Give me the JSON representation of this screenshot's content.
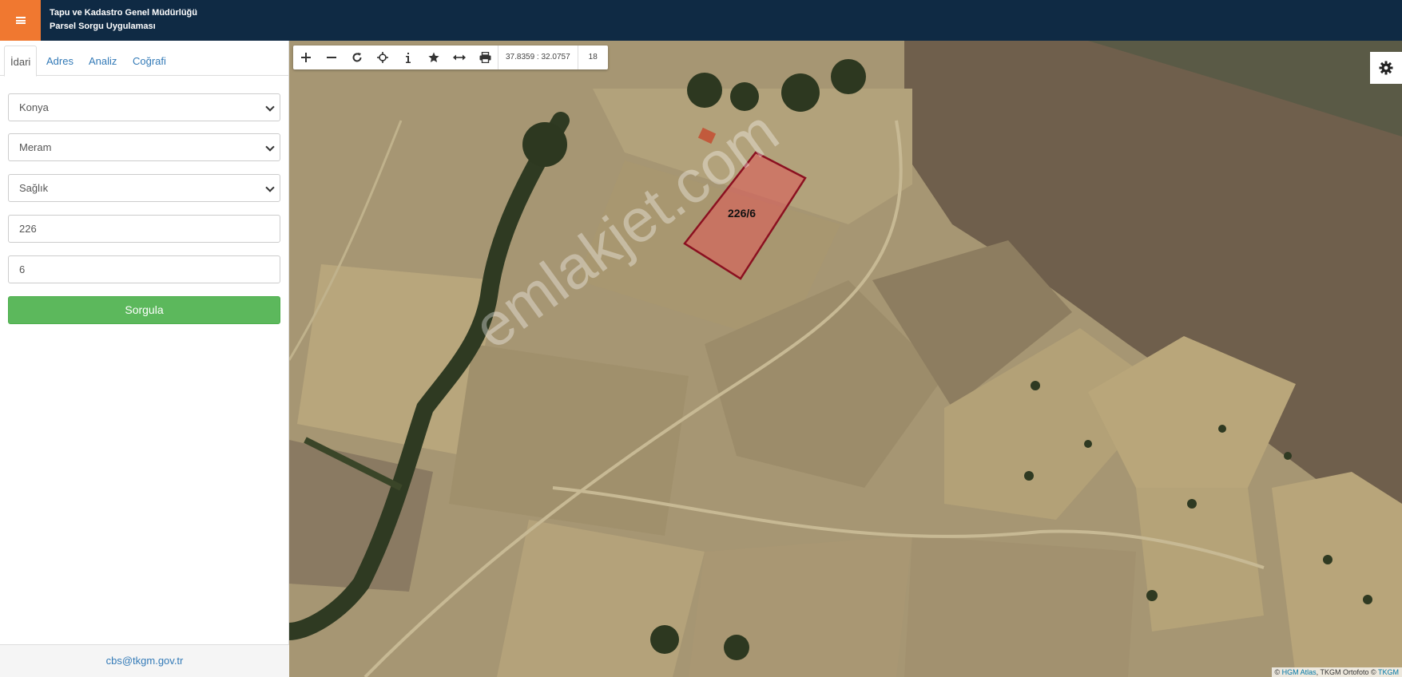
{
  "header": {
    "title_line1": "Tapu ve Kadastro Genel Müdürlüğü",
    "title_line2": "Parsel Sorgu Uygulaması"
  },
  "sidebar": {
    "tabs": [
      {
        "label": "İdari",
        "active": true
      },
      {
        "label": "Adres",
        "active": false
      },
      {
        "label": "Analiz",
        "active": false
      },
      {
        "label": "Coğrafi",
        "active": false
      }
    ],
    "province": "Konya",
    "district": "Meram",
    "neighborhood": "Sağlık",
    "block": "226",
    "parcel": "6",
    "query_button": "Sorgula",
    "footer_email": "cbs@tkgm.gov.tr"
  },
  "map": {
    "toolbar": {
      "coordinates": "37.8359 : 32.0757",
      "zoom": "18"
    },
    "parcel_label": "226/6",
    "watermark": "emlakjet.com",
    "attribution": {
      "prefix": "©",
      "hgm": "HGM Atlas",
      "middle": ", TKGM Ortofoto ©",
      "tkgm": "TKGM"
    },
    "parcel_color": "#e05858",
    "parcel_border": "#8b1020"
  },
  "colors": {
    "header_bg": "#0f2a44",
    "menu_btn": "#f07830",
    "query_btn": "#5cb85c",
    "link": "#337ab7"
  }
}
